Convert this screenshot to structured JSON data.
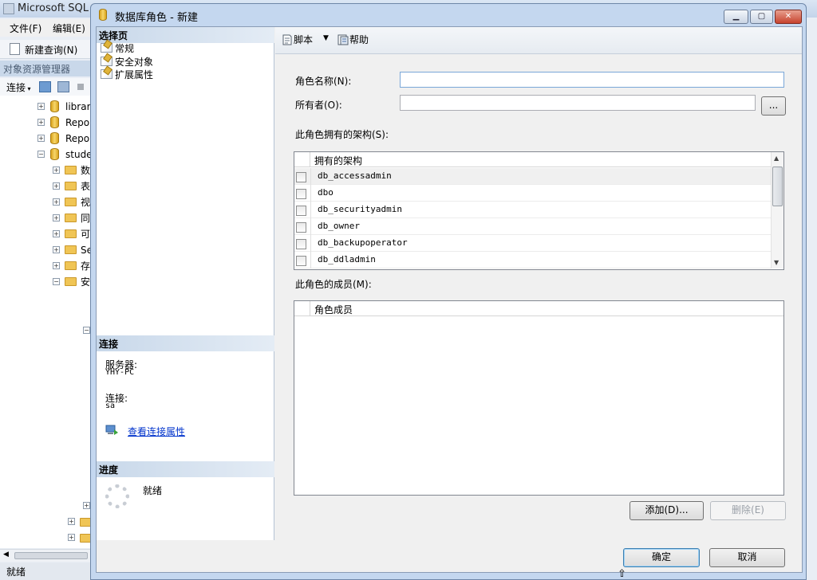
{
  "app_window": {
    "title": "Microsoft SQL",
    "menu": [
      "文件(F)",
      "编辑(E)"
    ],
    "toolbar_new_query": "新建查询(N)",
    "object_explorer": {
      "header": "对象资源管理器",
      "connect_label": "连接",
      "tree": [
        {
          "label": "librar",
          "expander": "+"
        },
        {
          "label": "Repo",
          "expander": "+"
        },
        {
          "label": "Repo",
          "expander": "+"
        },
        {
          "label": "stude",
          "expander": "−"
        },
        {
          "label": "数",
          "expander": "+"
        },
        {
          "label": "表",
          "expander": "+"
        },
        {
          "label": "视",
          "expander": "+"
        },
        {
          "label": "同",
          "expander": "+"
        },
        {
          "label": "可",
          "expander": "+"
        },
        {
          "label": "Se",
          "expander": "+"
        },
        {
          "label": "存",
          "expander": "+"
        },
        {
          "label": "安",
          "expander": "−"
        }
      ]
    },
    "status_text": "就绪"
  },
  "dialog": {
    "title": "数据库角色 - 新建",
    "select_page": {
      "header": "选择页",
      "items": [
        "常规",
        "安全对象",
        "扩展属性"
      ]
    },
    "connection": {
      "header": "连接",
      "server_label": "服务器:",
      "server_value": "YHY-PC",
      "conn_label": "连接:",
      "conn_value": "sa",
      "view_props_link": "查看连接属性"
    },
    "progress": {
      "header": "进度",
      "status": "就绪"
    },
    "toolbar": {
      "script_label": "脚本",
      "help_label": "帮助"
    },
    "form": {
      "role_name_label": "角色名称(N):",
      "role_name_value": "",
      "owner_label": "所有者(O):",
      "owner_value": "",
      "browse_button": "...",
      "owned_schemas_label": "此角色拥有的架构(S):",
      "schemas_header": "拥有的架构",
      "schemas": [
        {
          "name": "db_accessadmin",
          "checked": false
        },
        {
          "name": "dbo",
          "checked": false
        },
        {
          "name": "db_securityadmin",
          "checked": false
        },
        {
          "name": "db_owner",
          "checked": false
        },
        {
          "name": "db_backupoperator",
          "checked": false
        },
        {
          "name": "db_ddladmin",
          "checked": false
        }
      ],
      "members_label": "此角色的成员(M):",
      "members_header": "角色成员",
      "add_button": "添加(D)...",
      "remove_button": "删除(E)"
    },
    "ok_button": "确定",
    "cancel_button": "取消"
  }
}
